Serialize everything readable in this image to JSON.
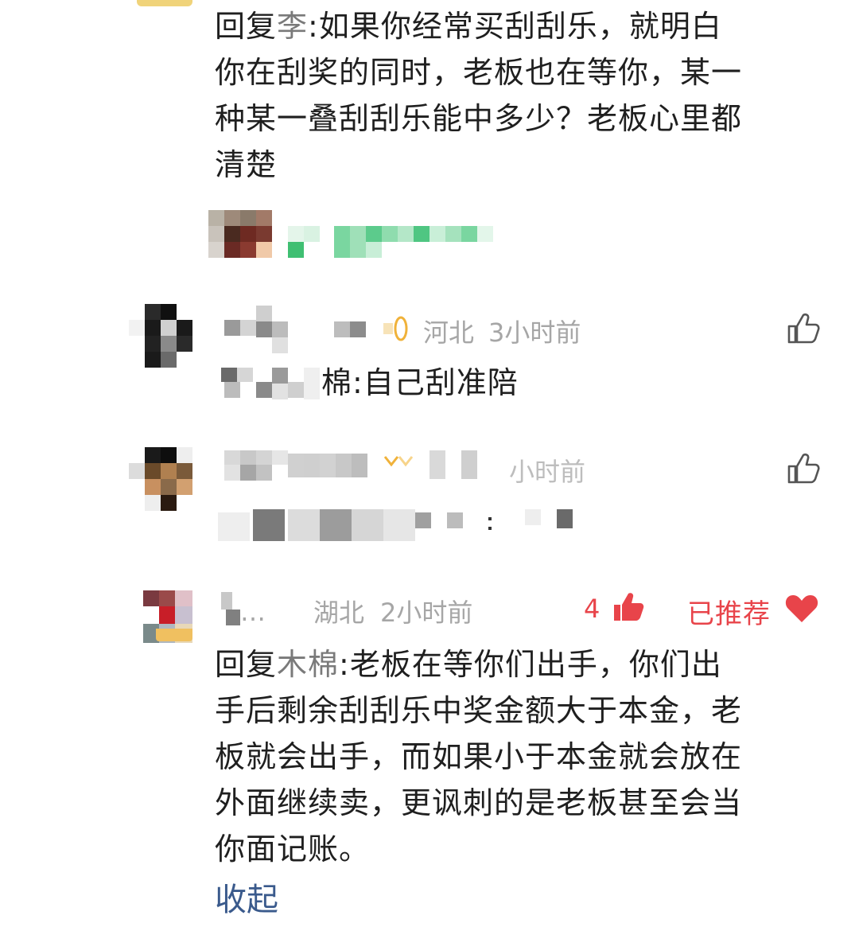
{
  "comment1": {
    "reply_prefix": "回复",
    "reply_to": "李",
    "text_lines": [
      ":如果你经常买刮刮乐，就明白",
      "你在刮奖的同时，老板也在等你，某一",
      "种某一叠刮刮乐能中多少？老板心里都",
      "清楚"
    ]
  },
  "comment2": {
    "location": "河北",
    "time": "3小时前",
    "reply_partial": "棉:自己刮准陪"
  },
  "comment3": {
    "time_partial": "小时前"
  },
  "comment4": {
    "username": "…",
    "location": "湖北",
    "time": "2小时前",
    "like_count": "4",
    "recommended_label": "已推荐",
    "reply_prefix": "回复",
    "reply_to": "木棉",
    "text_lines": [
      ":老板在等你们出手，你们出",
      "手后剩余刮刮乐中奖金额大于本金，老",
      "板就会出手，而如果小于本金就会放在",
      "外面继续卖，更讽刺的是老板甚至会当",
      "你面记账。"
    ],
    "collapse_label": "收起"
  },
  "icons": {
    "like": "thumbs-up-icon",
    "liked": "thumbs-up-filled-icon",
    "heart": "heart-icon",
    "badge": "medal-badge-icon"
  },
  "colors": {
    "text": "#1f1f1f",
    "meta": "#a6a6a6",
    "accent_red": "#e8444a",
    "link_blue": "#3a5a8c"
  }
}
